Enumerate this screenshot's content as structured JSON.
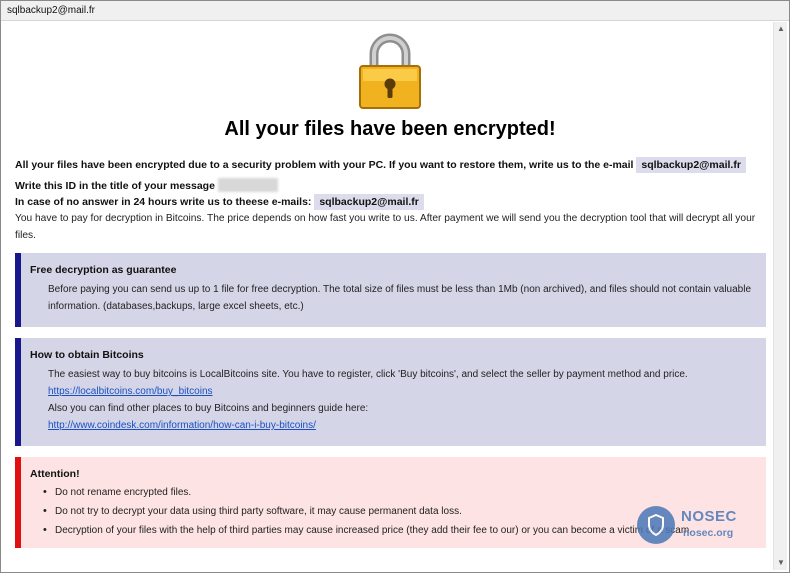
{
  "window": {
    "title": "sqlbackup2@mail.fr"
  },
  "icons": {
    "lock": "padlock-icon",
    "scroll_up": "arrow-up-icon",
    "scroll_down": "arrow-down-icon",
    "watermark": "nosec-shield-icon"
  },
  "headline": "All your files have been encrypted!",
  "intro": {
    "line1_text": "All your files have been encrypted due to a security problem with your PC. If you want to restore them, write us to the e-mail",
    "email": "sqlbackup2@mail.fr",
    "line2_text": "Write this ID in the title of your message",
    "line3_text": "In case of no answer in 24 hours write us to theese e-mails:",
    "email2": "sqlbackup2@mail.fr",
    "para": "You have to pay for decryption in Bitcoins. The price depends on how fast you write to us. After payment we will send you the decryption tool that will decrypt all your files."
  },
  "free_decryption": {
    "heading": "Free decryption as guarantee",
    "text": "Before paying you can send us up to 1 file for free decryption. The total size of files must be less than 1Mb (non archived), and files should not contain valuable information. (databases,backups, large excel sheets, etc.)"
  },
  "bitcoins": {
    "heading": "How to obtain Bitcoins",
    "text1": "The easiest way to buy bitcoins is LocalBitcoins site. You have to register, click 'Buy bitcoins', and select the seller by payment method and price.",
    "link1": "https://localbitcoins.com/buy_bitcoins",
    "text2": "Also you can find other places to buy Bitcoins and beginners guide here:",
    "link2": "http://www.coindesk.com/information/how-can-i-buy-bitcoins/"
  },
  "attention": {
    "heading": "Attention!",
    "items": [
      "Do not rename encrypted files.",
      "Do not try to decrypt your data using third party software, it may cause permanent data loss.",
      "Decryption of your files with the help of third parties may cause increased price (they add their fee to our) or you can become a victim of a scam."
    ]
  },
  "watermark": {
    "brand": "NOSEC",
    "site": "nosec.org"
  },
  "colors": {
    "blue_bar": "#18188c",
    "red_bar": "#e01010",
    "blue_box": "#d5d5e8",
    "red_box": "#fde3e3",
    "link": "#1a4fc4"
  }
}
